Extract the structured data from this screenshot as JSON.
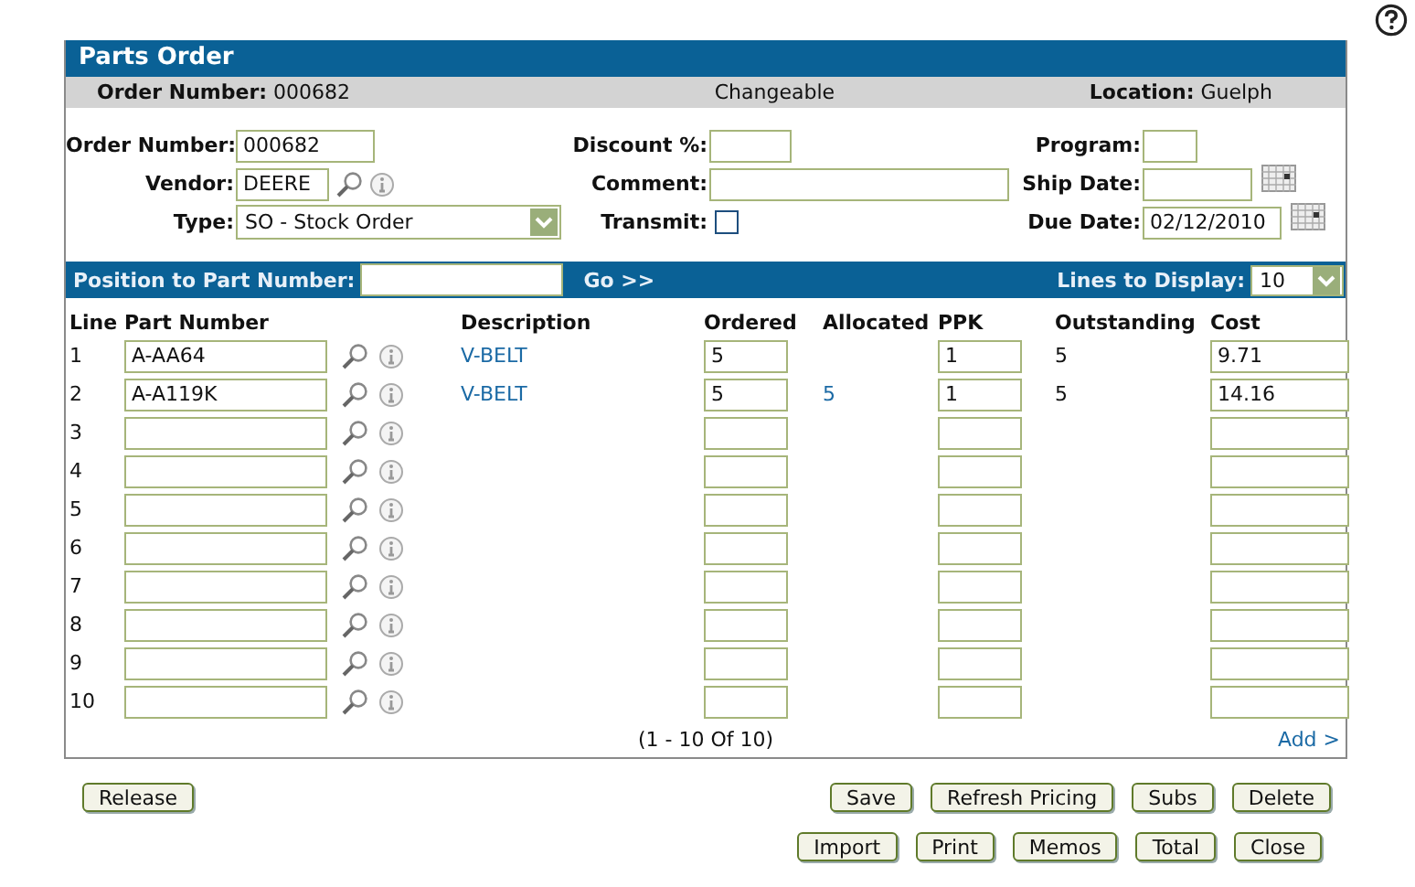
{
  "panel": {
    "title": "Parts Order"
  },
  "summary": {
    "order_label": "Order Number:",
    "order_value": "000682",
    "status": "Changeable",
    "location_label": "Location:",
    "location_value": "Guelph"
  },
  "form": {
    "order_number": {
      "label": "Order Number:",
      "value": "000682"
    },
    "vendor": {
      "label": "Vendor:",
      "value": "DEERE"
    },
    "type": {
      "label": "Type:",
      "value": "SO - Stock Order"
    },
    "discount": {
      "label": "Discount %:"
    },
    "comment": {
      "label": "Comment:"
    },
    "transmit": {
      "label": "Transmit:",
      "checked": false
    },
    "program": {
      "label": "Program:"
    },
    "ship_date": {
      "label": "Ship Date:"
    },
    "due_date": {
      "label": "Due Date:",
      "value": "02/12/2010"
    }
  },
  "position_bar": {
    "label": "Position to Part Number:",
    "go": "Go >>",
    "lines_label": "Lines to Display:",
    "lines_value": "10"
  },
  "table": {
    "columns": [
      "Line",
      "Part Number",
      "Description",
      "Ordered",
      "Allocated",
      "PPK",
      "Outstanding",
      "Cost"
    ],
    "rows": [
      {
        "line": "1",
        "part_number": "A-AA64",
        "description": "V-BELT",
        "ordered": "5",
        "ppk": "1",
        "outstanding": "5",
        "cost": "9.71"
      },
      {
        "line": "2",
        "part_number": "A-A119K",
        "description": "V-BELT",
        "ordered": "5",
        "allocated": "5",
        "ppk": "1",
        "outstanding": "5",
        "cost": "14.16"
      },
      {
        "line": "3"
      },
      {
        "line": "4"
      },
      {
        "line": "5"
      },
      {
        "line": "6"
      },
      {
        "line": "7"
      },
      {
        "line": "8"
      },
      {
        "line": "9"
      },
      {
        "line": "10"
      }
    ],
    "pagination": "(1  -  10  Of  10)",
    "add_link": "Add >"
  },
  "button_rows": [
    {
      "left": [
        "Release"
      ],
      "right": [
        "Save",
        "Refresh Pricing",
        "Subs",
        "Delete"
      ]
    },
    {
      "right": [
        "Import",
        "Print",
        "Memos",
        "Total",
        "Close"
      ]
    }
  ]
}
